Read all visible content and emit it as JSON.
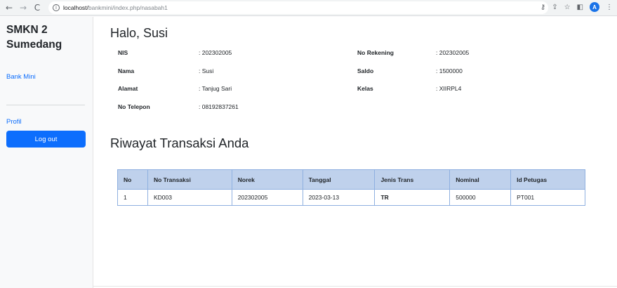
{
  "browser": {
    "back_icon": "←",
    "forward_icon": "→",
    "reload_icon": "C",
    "url_host": "localhost/",
    "url_path": "bankmini/index.php/nasabah1",
    "avatar_letter": "A",
    "right_icons": [
      "key-icon",
      "share-icon",
      "star-icon",
      "sidebar-icon",
      "profile-icon",
      "menu-icon"
    ]
  },
  "sidebar": {
    "brand": "SMKN 2 Sumedang",
    "bank_link": "Bank Mini",
    "profil_link": "Profil",
    "logout_label": "Log out"
  },
  "greeting": "Halo, Susi",
  "info": {
    "nis_label": "NIS",
    "nis_value": ": 202302005",
    "nama_label": "Nama",
    "nama_value": ": Susi",
    "alamat_label": "Alamat",
    "alamat_value": ": Tanjug Sari",
    "telepon_label": "No Telepon",
    "telepon_value": ": 08192837261",
    "rekening_label": "No Rekening",
    "rekening_value": ": 202302005",
    "saldo_label": "Saldo",
    "saldo_value": ": 1500000",
    "kelas_label": "Kelas",
    "kelas_value": ": XIIRPL4"
  },
  "history_title": "Riwayat Transaksi Anda",
  "table": {
    "headers": [
      "No",
      "No Transaksi",
      "Norek",
      "Tanggal",
      "Jenis Trans",
      "Nominal",
      "Id Petugas"
    ],
    "rows": [
      [
        "1",
        "KD003",
        "202302005",
        "2023-03-13",
        "TR",
        "500000",
        "PT001"
      ]
    ]
  },
  "colors": {
    "primary": "#0d6efd",
    "table_header": "#bfd1ec",
    "table_border": "#8fb0e0"
  }
}
